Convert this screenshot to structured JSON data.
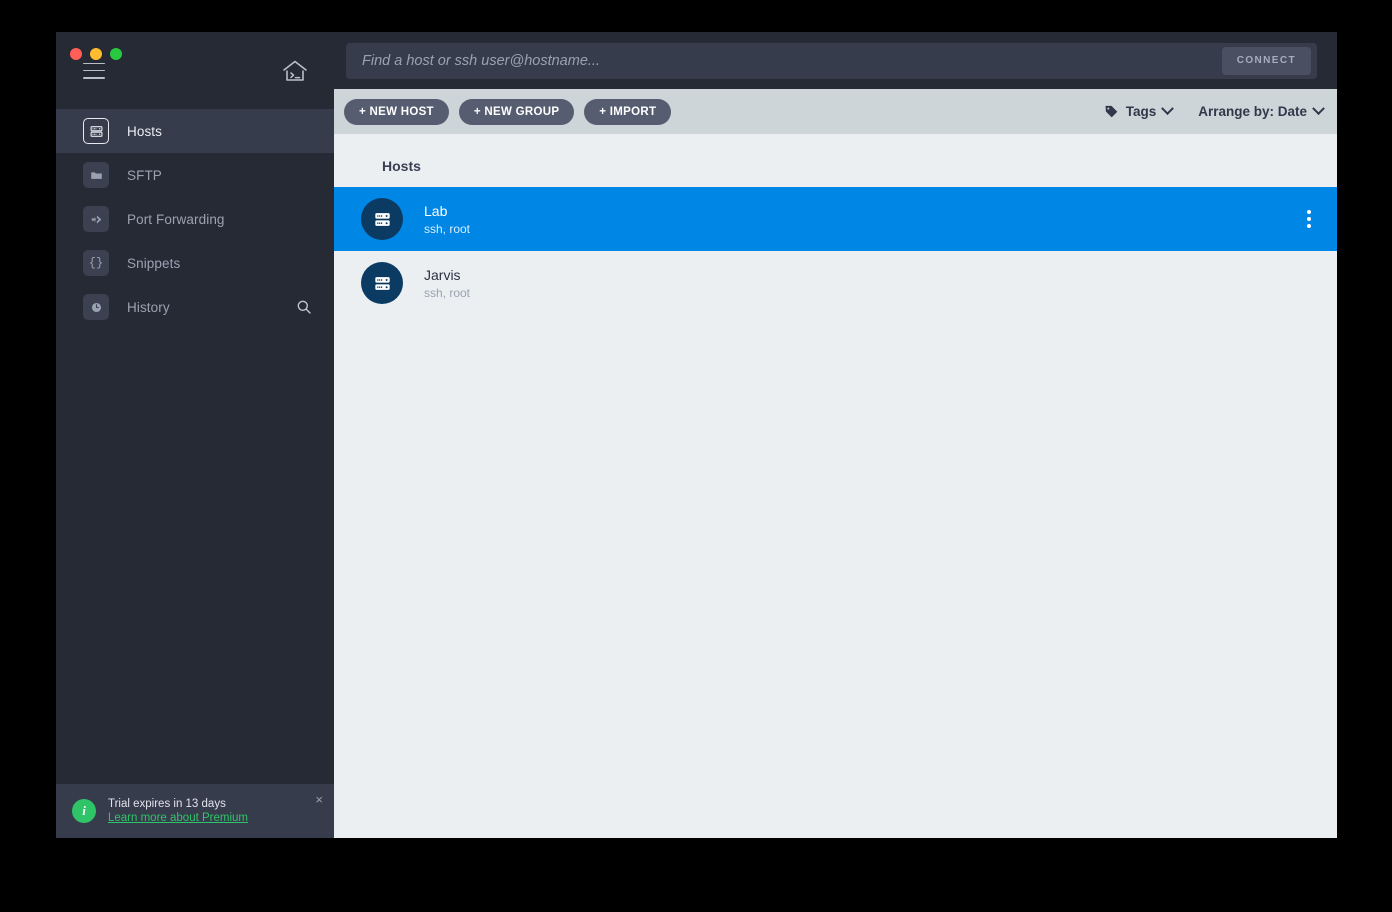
{
  "window": {
    "traffic_lights": [
      {
        "name": "close",
        "color": "#ff5f57"
      },
      {
        "name": "minimize",
        "color": "#febc2e"
      },
      {
        "name": "zoom",
        "color": "#28c840"
      }
    ]
  },
  "sidebar": {
    "menu_icon": "hamburger-icon",
    "home_icon": "home-terminal-icon",
    "items": [
      {
        "label": "Hosts",
        "icon": "server-rack-icon",
        "active": true
      },
      {
        "label": "SFTP",
        "icon": "folder-icon",
        "active": false
      },
      {
        "label": "Port Forwarding",
        "icon": "port-forward-icon",
        "active": false
      },
      {
        "label": "Snippets",
        "icon": "braces-icon",
        "active": false
      },
      {
        "label": "History",
        "icon": "clock-icon",
        "active": false,
        "trailing_icon": "search-icon"
      }
    ],
    "trial": {
      "title": "Trial expires in 13 days",
      "link": "Learn more about Premium",
      "close": "×",
      "info_glyph": "i",
      "accent": "#2fc468"
    }
  },
  "search": {
    "placeholder": "Find a host or ssh user@hostname...",
    "value": "",
    "connect_label": "CONNECT"
  },
  "toolbar": {
    "buttons": [
      {
        "label": "+ NEW HOST",
        "name": "new-host-button"
      },
      {
        "label": "+ NEW GROUP",
        "name": "new-group-button"
      },
      {
        "label": "+ IMPORT",
        "name": "import-button"
      }
    ],
    "tags_label": "Tags",
    "tags_icon": "tag-icon",
    "arrange_label": "Arrange by: Date",
    "chevron_icon": "chevron-down-icon"
  },
  "content": {
    "section_title": "Hosts",
    "hosts": [
      {
        "name": "Lab",
        "subtitle": "ssh, root",
        "selected": true,
        "avatar_icon": "server-rack-icon",
        "menu_icon": "kebab-menu-icon"
      },
      {
        "name": "Jarvis",
        "subtitle": "ssh, root",
        "selected": false,
        "avatar_icon": "server-rack-icon",
        "menu_icon": ""
      }
    ]
  },
  "colors": {
    "sidebar_bg": "#262a35",
    "sidebar_active": "#373c4c",
    "toolbar_bg": "#ced5d9",
    "content_bg": "#eceff1",
    "selection_blue": "#0087e6",
    "avatar_navy": "#0b3b63"
  }
}
